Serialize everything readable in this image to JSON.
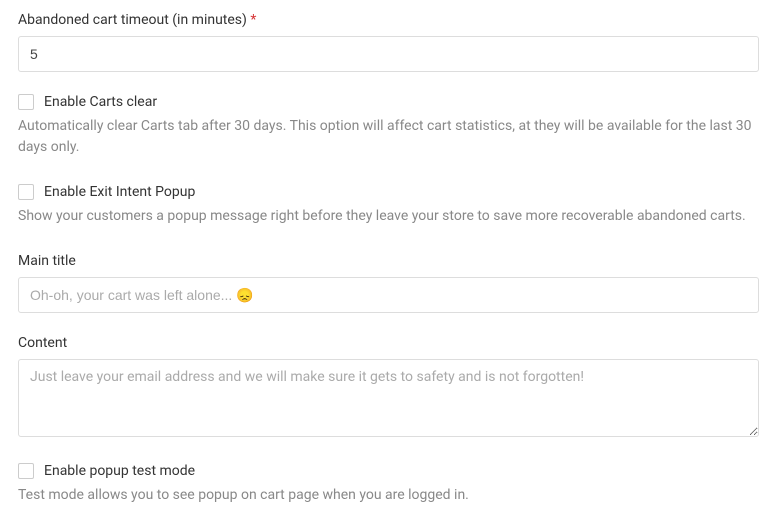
{
  "timeout": {
    "label": "Abandoned cart timeout (in minutes)",
    "value": "5"
  },
  "carts_clear": {
    "label": "Enable Carts clear",
    "description": "Automatically clear Carts tab after 30 days. This option will affect cart statistics, at they will be available for the last 30 days only."
  },
  "exit_intent": {
    "label": "Enable Exit Intent Popup",
    "description": "Show your customers a popup message right before they leave your store to save more recoverable abandoned carts."
  },
  "main_title": {
    "label": "Main title",
    "placeholder": "Oh-oh, your cart was left alone... 😞"
  },
  "content": {
    "label": "Content",
    "placeholder": "Just leave your email address and we will make sure it gets to safety and is not forgotten!"
  },
  "test_mode": {
    "label": "Enable popup test mode",
    "description": "Test mode allows you to see popup on cart page when you are logged in."
  }
}
